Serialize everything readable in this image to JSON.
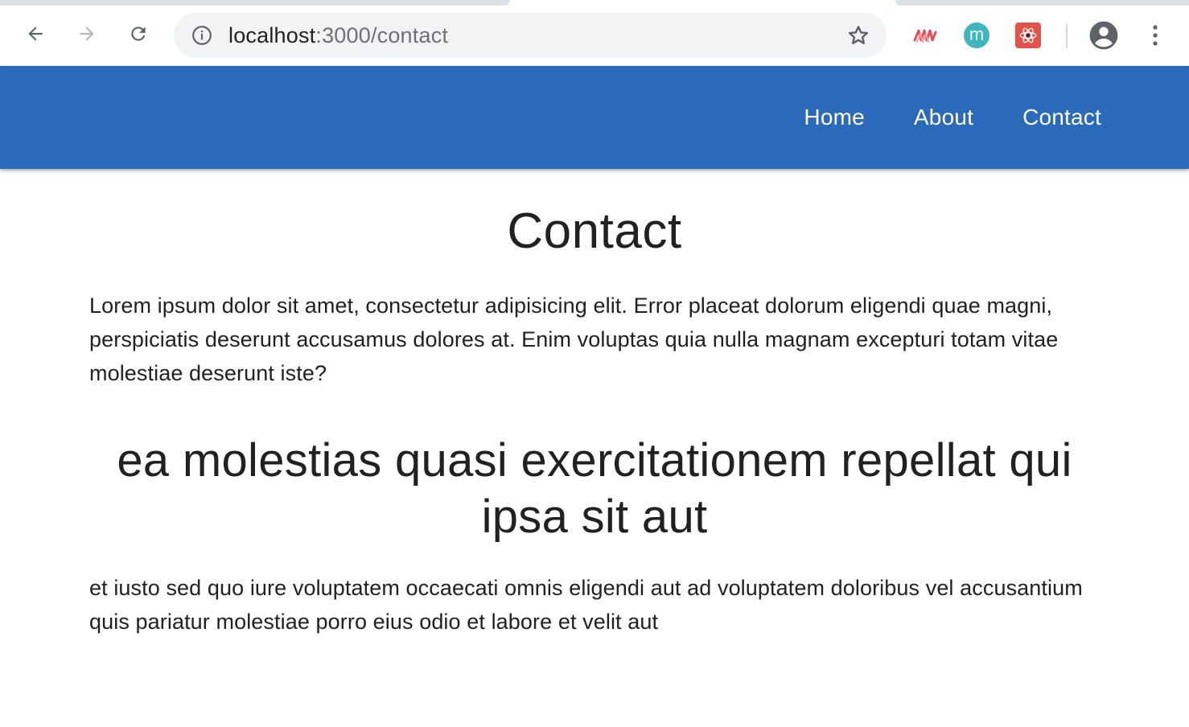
{
  "browser": {
    "url_host": "localhost",
    "url_rest": ":3000/contact",
    "colors": {
      "omnibox": "#f1f3f4",
      "icon": "#5f6368"
    }
  },
  "navbar": {
    "color": "#2b69bb",
    "links": [
      {
        "label": "Home"
      },
      {
        "label": "About"
      },
      {
        "label": "Contact"
      }
    ]
  },
  "main": {
    "title": "Contact",
    "intro": "Lorem ipsum dolor sit amet, consectetur adipisicing elit. Error placeat dolorum eligendi quae magni, perspiciatis deserunt accusamus dolores at. Enim voluptas quia nulla magnam excepturi totam vitae molestiae deserunt iste?",
    "post_title": "ea molestias quasi exercitationem repellat qui ipsa sit aut",
    "post_body": "et iusto sed quo iure voluptatem occaecati omnis eligendi aut ad voluptatem doloribus vel accusantium quis pariatur molestiae porro eius odio et labore et velit aut"
  }
}
